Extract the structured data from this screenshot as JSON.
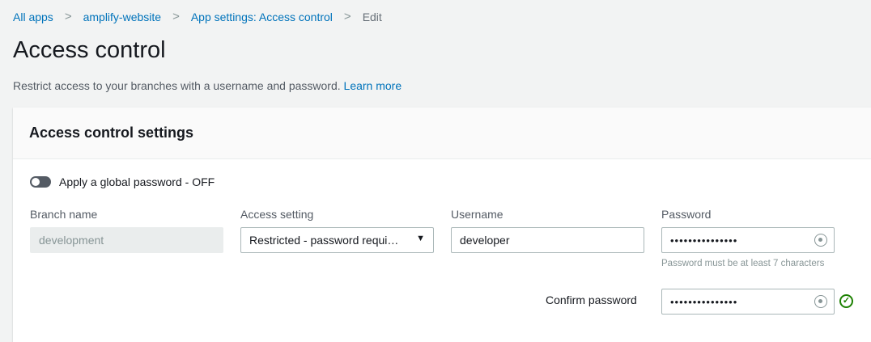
{
  "breadcrumb": [
    "All apps",
    "amplify-website",
    "App settings: Access control",
    "Edit"
  ],
  "title": "Access control",
  "description": "Restrict access to your branches with a username and password.",
  "learn_more": "Learn more",
  "card": {
    "title": "Access control settings",
    "toggle_label": "Apply a global password - OFF",
    "labels": {
      "branch": "Branch name",
      "access": "Access setting",
      "username": "Username",
      "password": "Password",
      "confirm": "Confirm password"
    },
    "branch_value": "development",
    "access_value": "Restricted - password requi…",
    "username_value": "developer",
    "password_value": "•••••••••••••••",
    "confirm_value": "•••••••••••••••",
    "password_hint": "Password must be at least 7 characters"
  }
}
